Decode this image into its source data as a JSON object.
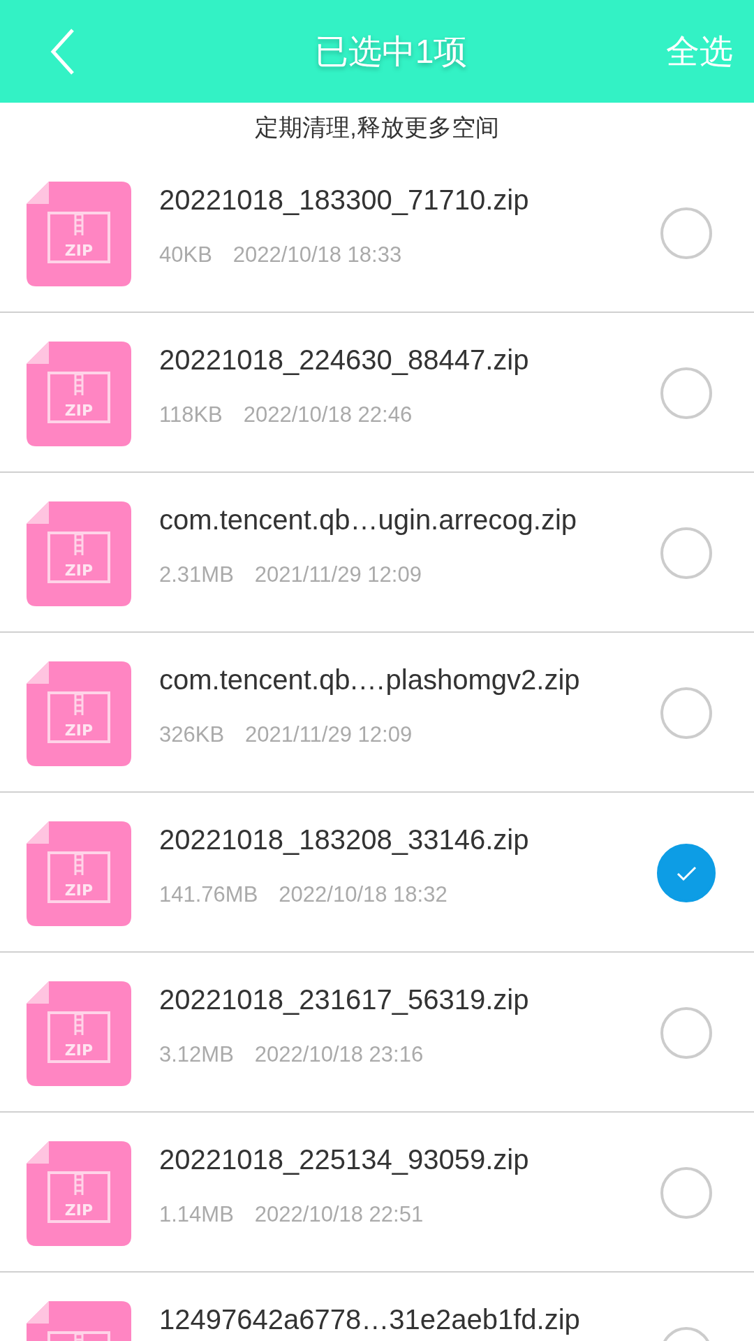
{
  "header": {
    "title": "已选中1项",
    "action": "全选"
  },
  "notice": "定期清理,释放更多空间",
  "files": [
    {
      "icon_label": "ZIP",
      "name": "20221018_183300_71710.zip",
      "size": "40KB",
      "date": "2022/10/18 18:33",
      "selected": false
    },
    {
      "icon_label": "ZIP",
      "name": "20221018_224630_88447.zip",
      "size": "118KB",
      "date": "2022/10/18 22:46",
      "selected": false
    },
    {
      "icon_label": "ZIP",
      "name": "com.tencent.qb…ugin.arrecog.zip",
      "size": "2.31MB",
      "date": "2021/11/29 12:09",
      "selected": false
    },
    {
      "icon_label": "ZIP",
      "name": "com.tencent.qb.…plashomgv2.zip",
      "size": "326KB",
      "date": "2021/11/29 12:09",
      "selected": false
    },
    {
      "icon_label": "ZIP",
      "name": "20221018_183208_33146.zip",
      "size": "141.76MB",
      "date": "2022/10/18 18:32",
      "selected": true
    },
    {
      "icon_label": "ZIP",
      "name": "20221018_231617_56319.zip",
      "size": "3.12MB",
      "date": "2022/10/18 23:16",
      "selected": false
    },
    {
      "icon_label": "ZIP",
      "name": "20221018_225134_93059.zip",
      "size": "1.14MB",
      "date": "2022/10/18 22:51",
      "selected": false
    },
    {
      "name": "12497642a6778…31e2aeb1fd.zip",
      "selected": false
    }
  ]
}
